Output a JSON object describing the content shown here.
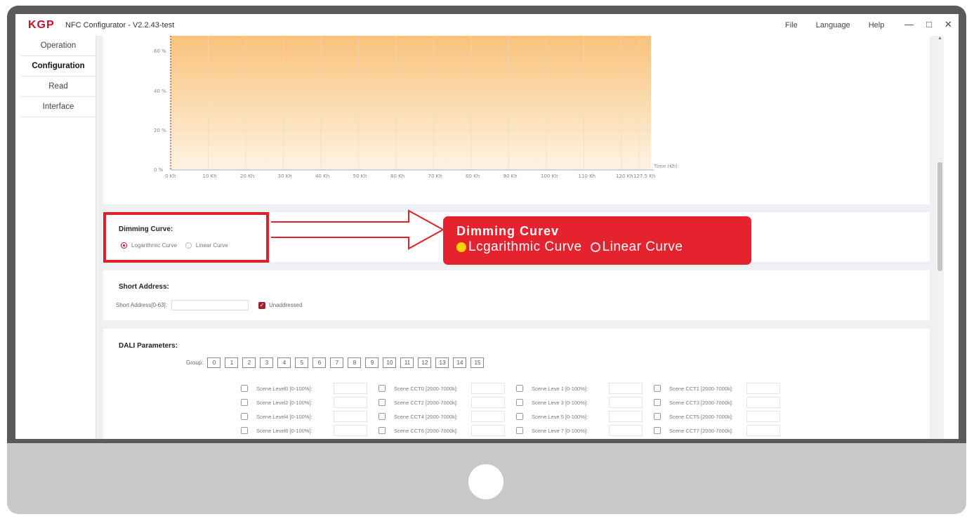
{
  "app": {
    "logo": "KGP",
    "title": "NFC Configurator - V2.2.43-test",
    "menus": [
      "File",
      "Language",
      "Help"
    ],
    "window_controls": [
      "minimize-icon",
      "maximize-icon",
      "close-icon"
    ]
  },
  "sidebar": {
    "items": [
      {
        "label": "Operation",
        "active": false
      },
      {
        "label": "Configuration",
        "active": true
      },
      {
        "label": "Read",
        "active": false
      },
      {
        "label": "Interface",
        "active": false
      }
    ]
  },
  "chart_data": {
    "type": "area",
    "y_ticks": [
      "60 %",
      "40 %",
      "20 %",
      "0 %"
    ],
    "x_ticks": [
      "0 Kh",
      "10 Kh",
      "20 Kh",
      "30 Kh",
      "40 Kh",
      "50 Kh",
      "60 Kh",
      "70 Kh",
      "80 Kh",
      "90 Kh",
      "100 Kh",
      "110 Kh",
      "120 Kh",
      "127.5 Kh"
    ],
    "xlabel": "Time (Kh)",
    "fill_colors": [
      "#f9c27a",
      "#fdf3e3"
    ],
    "grid": true
  },
  "dimming_curve": {
    "title": "Dimming Curve:",
    "options": [
      {
        "label": "Logarithmic Curve",
        "selected": true
      },
      {
        "label": "Linear Curve",
        "selected": false
      }
    ]
  },
  "callout": {
    "title": "Dimming Curev",
    "options": [
      {
        "label": "Lcgarithmic Curve",
        "selected": true
      },
      {
        "label": "Linear Curve",
        "selected": false
      }
    ],
    "color": "#e5232f"
  },
  "short_address": {
    "title": "Short Address:",
    "label": "Short Address[0-63]:",
    "value": "",
    "unaddressed_label": "Unaddressed",
    "unaddressed_checked": true
  },
  "dali": {
    "title": "DALI Parameters:",
    "group_label": "Group:",
    "groups": [
      "0",
      "1",
      "2",
      "3",
      "4",
      "5",
      "6",
      "7",
      "8",
      "9",
      "10",
      "11",
      "12",
      "13",
      "14",
      "15"
    ],
    "scene_rows": [
      [
        "Scene Level0 [0-100%]:",
        "Scene CCT0 [2000-7000k]:",
        "Scene Leve 1 [0-100%]:",
        "Scene CCT1 [2000-7000k]:"
      ],
      [
        "Scene Level2 [0-100%]:",
        "Scene CCT2 [2000-7000k]:",
        "Scene Leve 3 [0-100%]:",
        "Scene CCT3 [2000-7000k]:"
      ],
      [
        "Scene Level4 [0-100%]:",
        "Scene CCT4 [2000-7000k]:",
        "Scene Leve 5 [0-100%]:",
        "Scene CCT5 [2000-7000k]:"
      ],
      [
        "Scene Level6 [0-100%]:",
        "Scene CCT6 [2000-7000k]:",
        "Scene Leve 7 [0-100%]:",
        "Scene CCT7 [2000-7000k]:"
      ]
    ]
  }
}
